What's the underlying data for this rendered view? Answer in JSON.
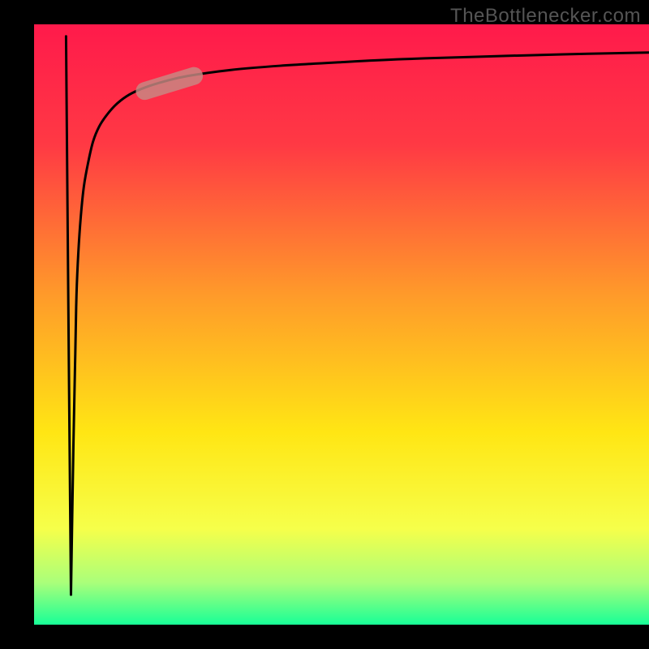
{
  "chart_data": {
    "type": "line",
    "title": "",
    "xlabel": "",
    "ylabel": "",
    "xlim": [
      0,
      100
    ],
    "ylim": [
      0,
      100
    ],
    "source": "TheBottlenecker.com",
    "curve_x": [
      6.0,
      6.4,
      6.7,
      6.9,
      7.2,
      7.6,
      8.1,
      8.8,
      9.6,
      10.6,
      11.9,
      13.5,
      15.5,
      18.1,
      21.2,
      25.0,
      32.0,
      40.0,
      50.0,
      60.0,
      72.0,
      86.0,
      100.0
    ],
    "curve_y": [
      5.0,
      30.0,
      45.0,
      55.0,
      62.0,
      68.0,
      73.0,
      77.0,
      80.5,
      83.0,
      85.0,
      86.8,
      88.3,
      89.5,
      90.5,
      91.4,
      92.4,
      93.1,
      93.7,
      94.2,
      94.6,
      95.0,
      95.3
    ],
    "spike_x": [
      5.2,
      5.6,
      6.0
    ],
    "spike_y": [
      98.0,
      50.0,
      5.0
    ],
    "highlight_segment": {
      "x0": 18.0,
      "y0": 88.9,
      "x1": 26.0,
      "y1": 91.4
    },
    "background_gradient_stops": [
      {
        "offset": 0,
        "color": "#ff1a4b"
      },
      {
        "offset": 20,
        "color": "#ff3944"
      },
      {
        "offset": 45,
        "color": "#ff9a2a"
      },
      {
        "offset": 68,
        "color": "#ffe614"
      },
      {
        "offset": 84,
        "color": "#f6ff4a"
      },
      {
        "offset": 93,
        "color": "#aaff7a"
      },
      {
        "offset": 100,
        "color": "#18ff97"
      }
    ]
  }
}
